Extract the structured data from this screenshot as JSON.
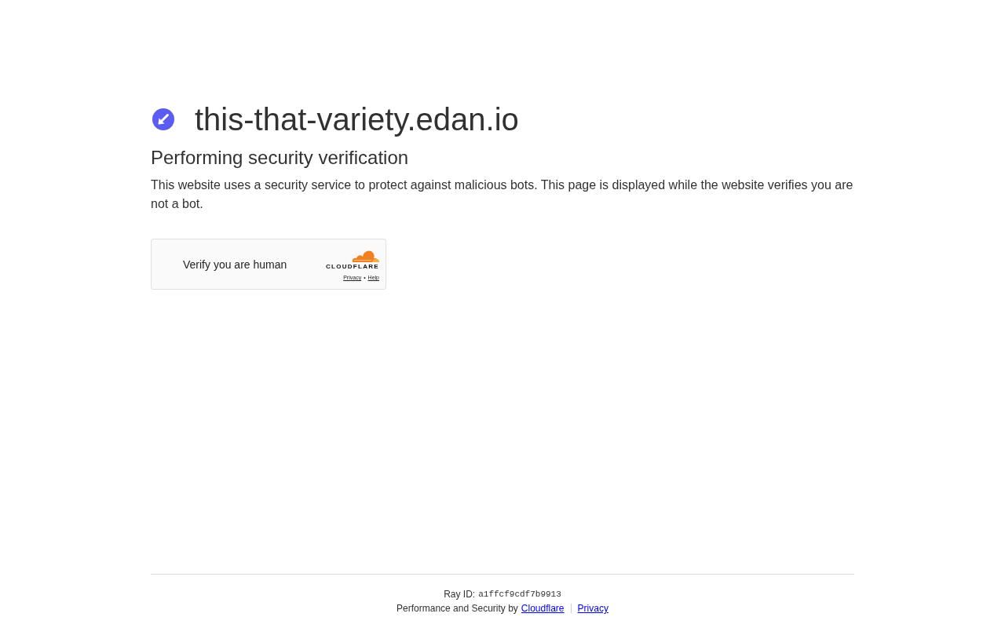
{
  "site": {
    "domain": "this-that-variety.edan.io"
  },
  "heading": "Performing security verification",
  "description": "This website uses a security service to protect against malicious bots. This page is displayed while the website verifies you are not a bot.",
  "challenge_widget": {
    "label": "Verify you are human",
    "brand": "CLOUDFLARE",
    "links": [
      "Privacy",
      "Help"
    ],
    "separator": "•"
  },
  "footer": {
    "ray_id_label": "Ray ID:",
    "ray_id": "a1ffcf9cdf7b9913",
    "credit": "Performance and Security by",
    "links": [
      "Cloudflare",
      "Privacy"
    ]
  }
}
